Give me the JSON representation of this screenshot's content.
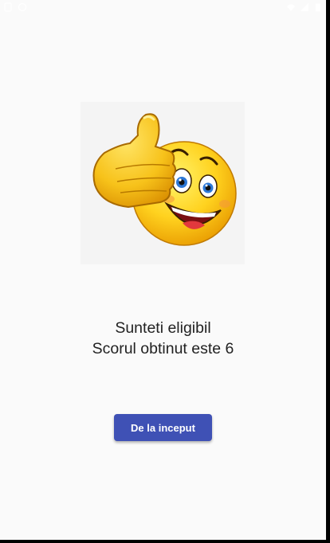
{
  "status_bar": {
    "left_icons": [
      "sim-icon",
      "app-notification-icon"
    ],
    "right_icons": [
      "wifi-icon",
      "signal-icon",
      "battery-icon"
    ]
  },
  "emoji": {
    "icon": "thumbs-up-smiley-icon"
  },
  "message": {
    "line1": "Sunteti eligibil",
    "line2": "Scorul obtinut este 6"
  },
  "restart_button": {
    "label": "De la inceput"
  },
  "colors": {
    "background": "#fafafa",
    "button": "#3f51b5",
    "text": "#222222"
  }
}
